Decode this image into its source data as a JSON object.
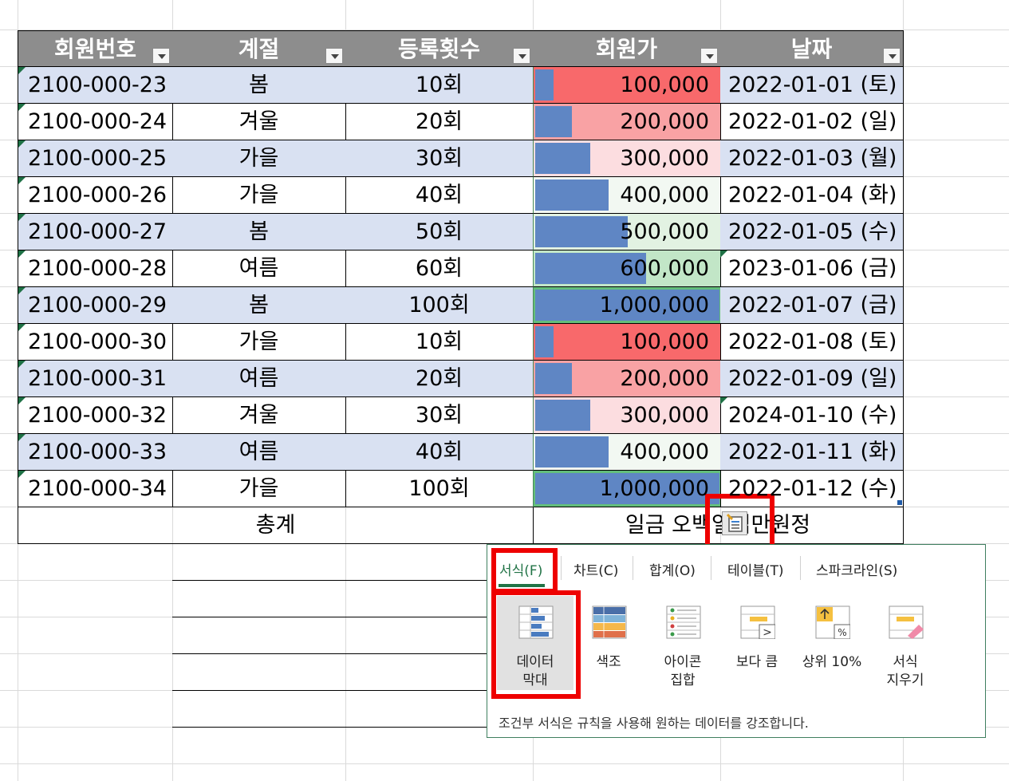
{
  "headers": [
    "회원번호",
    "계절",
    "등록횟수",
    "회원가",
    "날짜"
  ],
  "rows": [
    [
      "2100-000-23",
      "봄",
      "10회",
      "100,000",
      "2022-01-01 (토)"
    ],
    [
      "2100-000-24",
      "겨울",
      "20회",
      "200,000",
      "2022-01-02 (일)"
    ],
    [
      "2100-000-25",
      "가을",
      "30회",
      "300,000",
      "2022-01-03 (월)"
    ],
    [
      "2100-000-26",
      "가을",
      "40회",
      "400,000",
      "2022-01-04 (화)"
    ],
    [
      "2100-000-27",
      "봄",
      "50회",
      "500,000",
      "2022-01-05 (수)"
    ],
    [
      "2100-000-28",
      "여름",
      "60회",
      "600,000",
      "2023-01-06 (금)"
    ],
    [
      "2100-000-29",
      "봄",
      "100회",
      "1,000,000",
      "2022-01-07 (금)"
    ],
    [
      "2100-000-30",
      "가을",
      "10회",
      "100,000",
      "2022-01-08 (토)"
    ],
    [
      "2100-000-31",
      "여름",
      "20회",
      "200,000",
      "2022-01-09 (일)"
    ],
    [
      "2100-000-32",
      "겨울",
      "30회",
      "300,000",
      "2024-01-10 (수)"
    ],
    [
      "2100-000-33",
      "여름",
      "40회",
      "400,000",
      "2022-01-11 (화)"
    ],
    [
      "2100-000-34",
      "가을",
      "100회",
      "1,000,000",
      "2022-01-12 (수)"
    ]
  ],
  "price_fraction": [
    0.1,
    0.2,
    0.3,
    0.4,
    0.5,
    0.6,
    1.0,
    0.1,
    0.2,
    0.3,
    0.4,
    1.0
  ],
  "price_bg_colors": [
    "#f8696b",
    "#f9a2a4",
    "#fcdde0",
    "#f2f8f2",
    "#e2f2e2",
    "#c2e6c7",
    "#63be7b",
    "#f8696b",
    "#f9a2a4",
    "#fcdde0",
    "#f2f8f2",
    "#63be7b"
  ],
  "date_marked_rows": [
    5,
    9
  ],
  "total_label": "총계",
  "total_value": "일금 오백일십만원정",
  "quick_analysis": {
    "tabs": [
      "서식(F)",
      "차트(C)",
      "합계(O)",
      "테이블(T)",
      "스파크라인(S)"
    ],
    "active_tab": "서식(F)",
    "options": [
      {
        "label": "데이터\n막대",
        "icon": "data-bar-icon",
        "selected": true
      },
      {
        "label": "색조",
        "icon": "color-scale-icon"
      },
      {
        "label": "아이콘\n집합",
        "icon": "icon-set-icon"
      },
      {
        "label": "보다 큼",
        "icon": "greater-than-icon"
      },
      {
        "label": "상위 10%",
        "icon": "top-ten-percent-icon"
      },
      {
        "label": "서식\n지우기",
        "icon": "clear-format-icon"
      }
    ],
    "description": "조건부 서식은 규칙을 사용해 원하는 데이터를 강조합니다."
  },
  "colors": {
    "bar": "#5f86c4",
    "header_bg": "#8d8d8d",
    "alt_row": "#d9e1f2",
    "highlight": "#ee0000",
    "accent": "#217346"
  }
}
